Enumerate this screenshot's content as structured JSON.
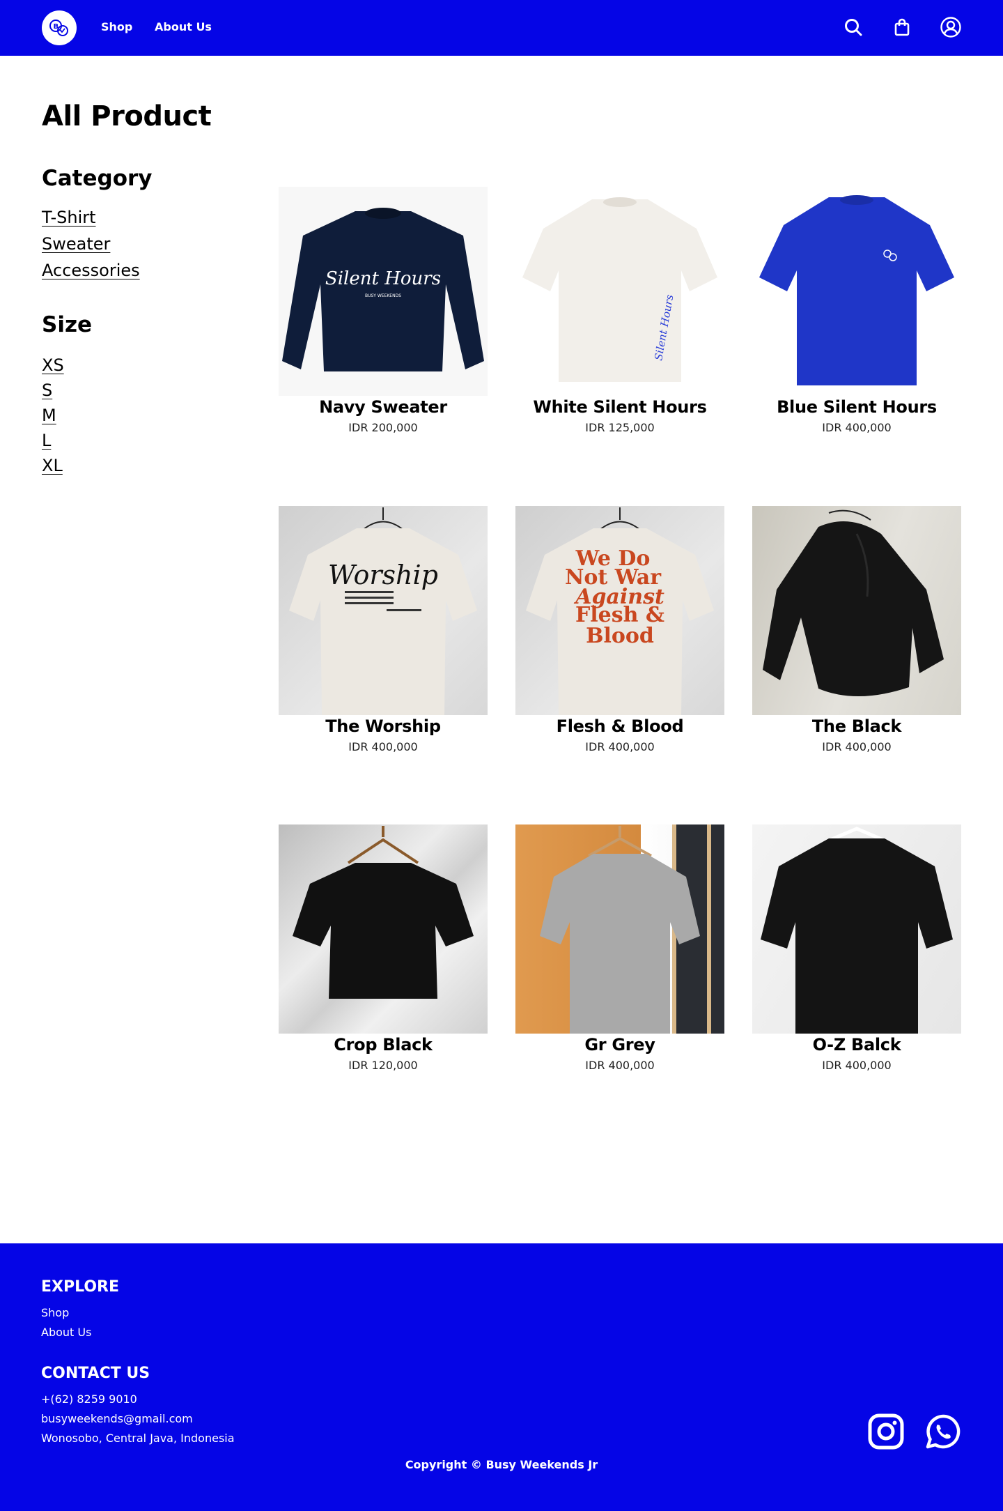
{
  "header": {
    "logo_alt": "Busy Weekends logo",
    "nav": [
      {
        "label": "Shop"
      },
      {
        "label": "About Us"
      }
    ],
    "icons": [
      "search-icon",
      "shopping-bag-icon",
      "user-account-icon"
    ]
  },
  "page_title": "All Product",
  "filters": {
    "category_heading": "Category",
    "categories": [
      "T-Shirt",
      "Sweater",
      "Accessories"
    ],
    "size_heading": "Size",
    "sizes": [
      "XS",
      "S",
      "M",
      "L",
      "XL"
    ]
  },
  "products": [
    {
      "name": "Navy Sweater",
      "price": "IDR 200,000",
      "color": "#0f1d3a"
    },
    {
      "name": "White Silent Hours",
      "price": "IDR 125,000",
      "color": "#f2efea"
    },
    {
      "name": "Blue Silent Hours",
      "price": "IDR 400,000",
      "color": "#1f36c8"
    },
    {
      "name": "The Worship",
      "price": "IDR 400,000",
      "color": "#ece8e1"
    },
    {
      "name": "Flesh & Blood",
      "price": "IDR 400,000",
      "color": "#ece8e1"
    },
    {
      "name": "The Black",
      "price": "IDR 400,000",
      "color": "#151515"
    },
    {
      "name": "Crop Black",
      "price": "IDR 120,000",
      "color": "#111111"
    },
    {
      "name": "Gr Grey",
      "price": "IDR 400,000",
      "color": "#a9a9a9"
    },
    {
      "name": "O-Z Balck",
      "price": "IDR 400,000",
      "color": "#141414"
    }
  ],
  "footer": {
    "explore_heading": "EXPLORE",
    "explore_links": [
      "Shop",
      "About Us"
    ],
    "contact_heading": "CONTACT US",
    "phone": "+(62) 8259 9010",
    "email": "busyweekends@gmail.com",
    "address": "Wonosobo, Central Java, Indonesia",
    "copyright": "Copyright © Busy Weekends Jr",
    "social_icons": [
      "instagram-icon",
      "whatsapp-icon"
    ]
  },
  "colors": {
    "brand_blue": "#0505e6",
    "background": "#ffffff"
  }
}
